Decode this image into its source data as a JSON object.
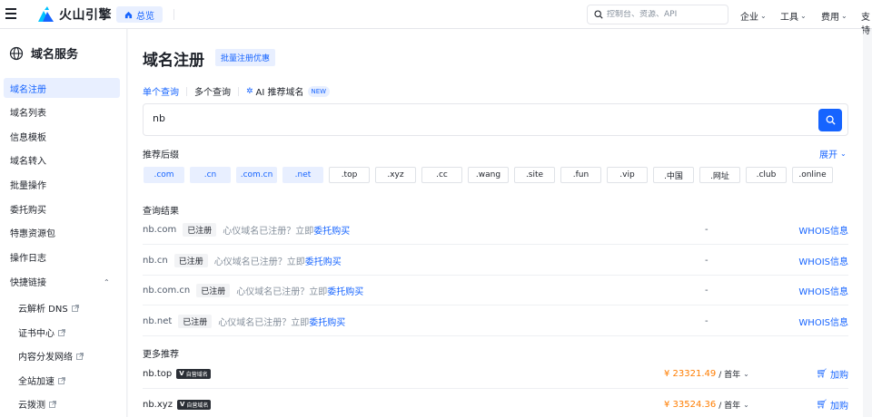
{
  "topbar": {
    "brand": "火山引擎",
    "home_label": "总览",
    "search_placeholder": "控制台、资源、API",
    "nav": [
      "企业",
      "工具",
      "费用",
      "支持"
    ]
  },
  "sidebar": {
    "title": "域名服务",
    "items": [
      "域名注册",
      "域名列表",
      "信息模板",
      "域名转入",
      "批量操作",
      "委托购买",
      "特惠资源包",
      "操作日志",
      "快捷链接"
    ],
    "quick_links": [
      "云解析 DNS",
      "证书中心",
      "内容分发网络",
      "全站加速",
      "云拨测"
    ]
  },
  "main": {
    "title": "域名注册",
    "promo": "批量注册优惠",
    "tabs": [
      "单个查询",
      "多个查询",
      "AI 推荐域名"
    ],
    "new_badge": "NEW",
    "query_value": "nb",
    "suffix_label": "推荐后缀",
    "expand_label": "展开",
    "suffixes": [
      ".com",
      ".cn",
      ".com.cn",
      ".net",
      ".top",
      ".xyz",
      ".cc",
      ".wang",
      ".site",
      ".fun",
      ".vip",
      ".中国",
      ".网址",
      ".club",
      ".online"
    ],
    "results_title": "查询结果",
    "registered_label": "已注册",
    "hint_text": "心仪域名已注册？立即",
    "hint_link": "委托购买",
    "whois_label": "WHOIS信息",
    "results": [
      {
        "domain": "nb.com",
        "price": "-"
      },
      {
        "domain": "nb.cn",
        "price": "-"
      },
      {
        "domain": "nb.com.cn",
        "price": "-"
      },
      {
        "domain": "nb.net",
        "price": "-"
      }
    ],
    "more_title": "更多推荐",
    "sale_tag": "自营域名",
    "sale_v": "V",
    "per_year": "/ 首年",
    "buy_label": "加购",
    "recommend": [
      {
        "domain": "nb.top",
        "price": "¥ 23321.49"
      },
      {
        "domain": "nb.xyz",
        "price": "¥ 33524.36"
      }
    ]
  },
  "colors": {
    "accent": "#1664ff",
    "price": "#ff7d00",
    "active_bg": "#e8efff"
  }
}
